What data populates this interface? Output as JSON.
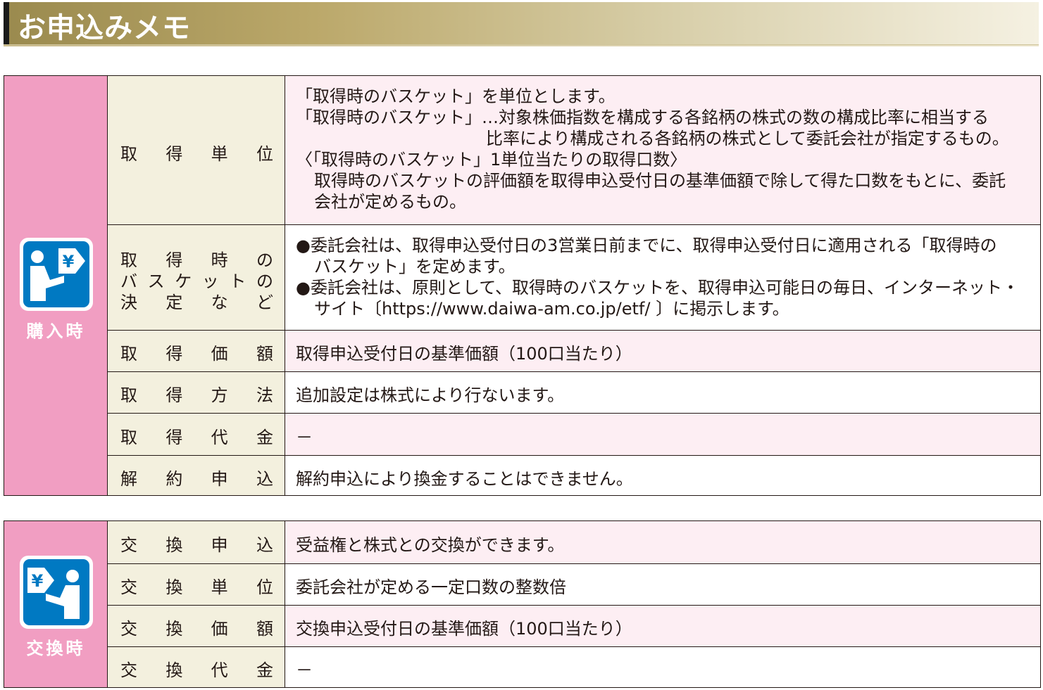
{
  "header": {
    "title": "お申込みメモ"
  },
  "purchase": {
    "side_label": "購入時",
    "icon": "person-yen-arrow-right-icon",
    "rows": [
      {
        "label": "取得単位",
        "lines": [
          "「取得時のバスケット」を単位とします。",
          "「取得時のバスケット」…対象株価指数を構成する各銘柄の株式の数の構成比率に相当する",
          "比率により構成される各銘柄の株式として委託会社が指定するもの。",
          "〈「取得時のバスケット」1単位当たりの取得口数〉",
          "取得時のバスケットの評価額を取得申込受付日の基準価額で除して得た口数をもとに、委託",
          "会社が定めるもの。"
        ]
      },
      {
        "label_lines": [
          "取得時の",
          "バスケットの",
          "決定など"
        ],
        "lines": [
          "●委託会社は、取得申込受付日の3営業日前までに、取得申込受付日に適用される「取得時の",
          "バスケット」を定めます。",
          "●委託会社は、原則として、取得時のバスケットを、取得申込可能日の毎日、インターネット・",
          "サイト〔https://www.daiwa-am.co.jp/etf/ 〕に掲示します。"
        ]
      },
      {
        "label": "取得価額",
        "text": "取得申込受付日の基準価額（100口当たり）"
      },
      {
        "label": "取得方法",
        "text": "追加設定は株式により行ないます。"
      },
      {
        "label": "取得代金",
        "text": "－"
      },
      {
        "label": "解約申込",
        "text": "解約申込により換金することはできません。"
      }
    ]
  },
  "exchange": {
    "side_label": "交換時",
    "icon": "yen-arrow-person-icon",
    "rows": [
      {
        "label": "交換申込",
        "text": "受益権と株式との交換ができます。"
      },
      {
        "label": "交換単位",
        "text": "委託会社が定める一定口数の整数倍"
      },
      {
        "label": "交換価額",
        "text": "交換申込受付日の基準価額（100口当たり）"
      },
      {
        "label": "交換代金",
        "text": "－"
      }
    ]
  },
  "colors": {
    "sidebar": "#f19ec2",
    "label_bg": "#f3f0de",
    "pink_bg": "#fdeef3",
    "icon_blue": "#0079c2"
  }
}
